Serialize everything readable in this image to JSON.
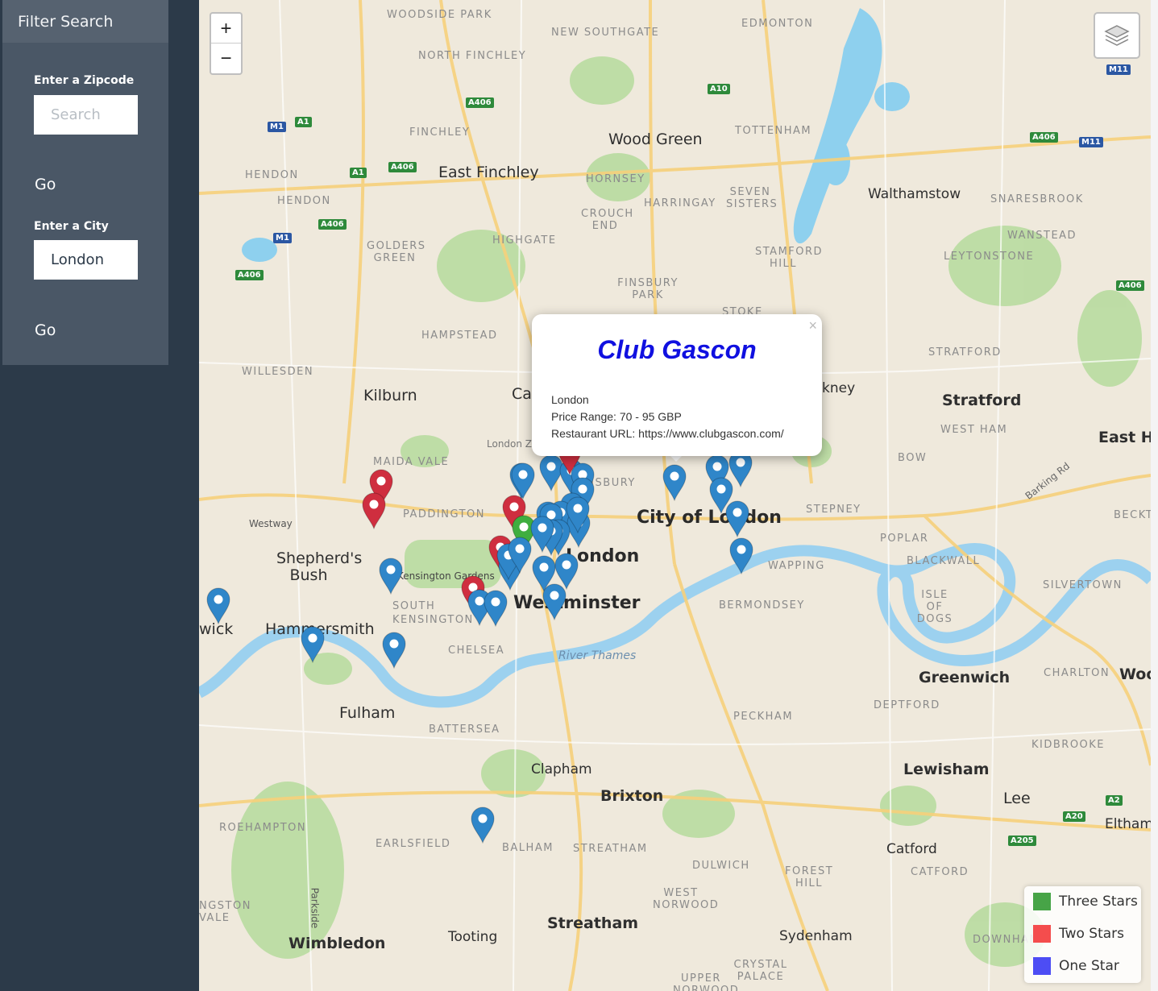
{
  "sidebar": {
    "header": "Filter Search",
    "zipcode": {
      "label": "Enter a Zipcode",
      "placeholder": "Search",
      "value": "",
      "go_label": "Go"
    },
    "city": {
      "label": "Enter a City",
      "value": "London",
      "go_label": "Go"
    }
  },
  "map": {
    "zoom_in": "+",
    "zoom_out": "−",
    "labels": {
      "woodside_park": "WOODSIDE PARK",
      "new_southgate": "NEW SOUTHGATE",
      "edmonton": "EDMONTON",
      "north_finchley": "NORTH FINCHLEY",
      "finchley": "FINCHLEY",
      "wood_green": "Wood Green",
      "tottenham": "TOTTENHAM",
      "hendon_1": "HENDON",
      "hendon_2": "HENDON",
      "east_finchley": "East Finchley",
      "hornsey": "HORNSEY",
      "walthamstow": "Walthamstow",
      "snaresbrook": "SNARESBROOK",
      "harringay": "HARRINGAY",
      "seven_sisters": "SEVEN SISTERS",
      "crouch_end": "CROUCH END",
      "wanstead": "WANSTEAD",
      "golders_green": "GOLDERS GREEN",
      "highgate": "HIGHGATE",
      "stamford_hill": "STAMFORD HILL",
      "leytonstone": "LEYTONSTONE",
      "finsbury_park": "FINSBURY PARK",
      "hampstead": "HAMPSTEAD",
      "stoke": "STOKE",
      "stratford_small": "STRATFORD",
      "willesden": "WILLESDEN",
      "kilburn": "Kilburn",
      "stratford": "Stratford",
      "hackney": "kney",
      "west_ham": "WEST HAM",
      "east_ham": "East Ha",
      "maida_vale": "MAIDA VALE",
      "bow": "BOW",
      "barking_rd": "Barking Rd",
      "paddington": "PADDINGTON",
      "finsbury": "FINSBURY",
      "stepney": "STEPNEY",
      "beckton": "BECKT",
      "westway": "Westway",
      "city_of_london": "City of London",
      "poplar": "POPLAR",
      "shepherds_bush": "Shepherd's Bush",
      "london": "London",
      "blackwall": "BLACKWALL",
      "kensington_gardens": "Kensington Gardens",
      "wapping": "WAPPING",
      "silvertown": "SILVERTOWN",
      "westminster": "Westminster",
      "south_kensington": "SOUTH KENSINGTON",
      "isle_of_dogs": "ISLE OF DOGS",
      "hammersmith": "Hammersmith",
      "chiswick": "wick",
      "bermondsey": "BERMONDSEY",
      "chelsea": "CHELSEA",
      "river_thames": "River Thames",
      "greenwich": "Greenwich",
      "charlton": "CHARLTON",
      "woolwich": "Wool",
      "fulham": "Fulham",
      "peckham": "PECKHAM",
      "deptford": "DEPTFORD",
      "battersea": "BATTERSEA",
      "kidbrooke": "KIDBROOKE",
      "clapham": "Clapham",
      "lewisham": "Lewisham",
      "brixton": "Brixton",
      "lee": "Lee",
      "roehampton": "ROEHAMPTON",
      "earlsfield": "EARLSFIELD",
      "balham": "BALHAM",
      "streatham_small": "STREATHAM",
      "catford_big": "Catford",
      "eltham": "Eltham",
      "dulwich": "DULWICH",
      "forest_hill": "FOREST HILL",
      "catford": "CATFORD",
      "west_norwood": "WEST NORWOOD",
      "kingston_vale": "NGSTON VALE",
      "parkside": "Parkside",
      "streatham": "Streatham",
      "downham": "DOWNHAM",
      "wimbledon": "Wimbledon",
      "tooting": "Tooting",
      "sydenham": "Sydenham",
      "crystal_palace": "CRYSTAL PALACE",
      "upper_norwood": "UPPER NORWOOD",
      "camden": "Ca",
      "london_zoo": "London Z"
    },
    "road_badges": [
      "A1",
      "M1",
      "A406",
      "A10",
      "M11",
      "A406",
      "M11",
      "A1",
      "A406",
      "A406",
      "M1",
      "A406",
      "A406",
      "A2",
      "A20",
      "A205"
    ],
    "popup": {
      "title": "Club Gascon",
      "city": "London",
      "price": "Price Range: 70 - 95 GBP",
      "url": "Restaurant URL: https://www.clubgascon.com/",
      "close": "×"
    },
    "markers": [
      {
        "stars": 2
      },
      {
        "stars": 2
      },
      {
        "stars": 1
      },
      {
        "stars": 1
      },
      {
        "stars": 1
      },
      {
        "stars": 1
      },
      {
        "stars": 1
      },
      {
        "stars": 2
      },
      {
        "stars": 2
      },
      {
        "stars": 3
      },
      {
        "stars": 1
      },
      {
        "stars": 1
      },
      {
        "stars": 1
      },
      {
        "stars": 1
      },
      {
        "stars": 1
      },
      {
        "stars": 1
      },
      {
        "stars": 1
      },
      {
        "stars": 1
      },
      {
        "stars": 1
      },
      {
        "stars": 1
      },
      {
        "stars": 1
      },
      {
        "stars": 2
      },
      {
        "stars": 1
      },
      {
        "stars": 1
      },
      {
        "stars": 1
      },
      {
        "stars": 1
      },
      {
        "stars": 1
      },
      {
        "stars": 1
      },
      {
        "stars": 1
      },
      {
        "stars": 1
      },
      {
        "stars": 1
      },
      {
        "stars": 1
      },
      {
        "stars": 1
      },
      {
        "stars": 1
      },
      {
        "stars": 1
      },
      {
        "stars": 1
      },
      {
        "stars": 1
      },
      {
        "stars": 1
      },
      {
        "stars": 1
      },
      {
        "stars": 2
      },
      {
        "stars": 1
      }
    ],
    "legend": [
      {
        "label": "Three Stars",
        "color": "#47a447"
      },
      {
        "label": "Two Stars",
        "color": "#f44d4d"
      },
      {
        "label": "One Star",
        "color": "#4d4df4"
      }
    ],
    "colors": {
      "marker_one_star": "#2f86c9",
      "marker_two_stars": "#cf2e3f",
      "marker_three_stars": "#3fae3f",
      "popup_title": "#1010e0"
    }
  }
}
